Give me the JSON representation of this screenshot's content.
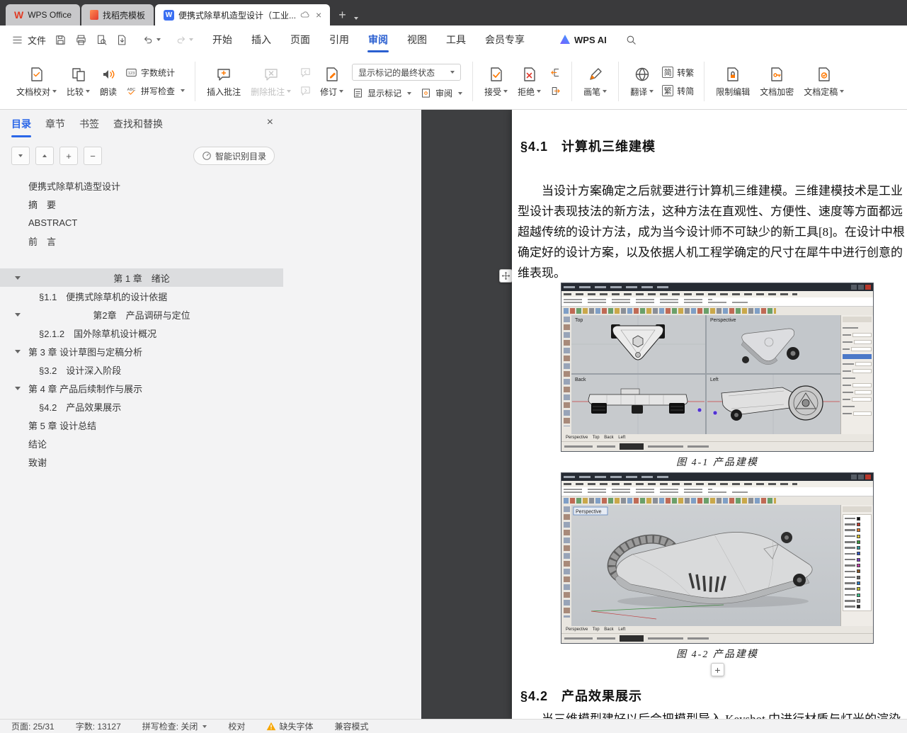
{
  "icons": {
    "close": "×",
    "plus": "+",
    "minus": "−"
  },
  "tabbar": {
    "tabs": [
      {
        "label": "WPS Office"
      },
      {
        "label": "找稻壳模板"
      },
      {
        "label": "便携式除草机造型设计（工业..."
      }
    ]
  },
  "menubar": {
    "menu": "文件",
    "tabs": [
      {
        "label": "开始"
      },
      {
        "label": "插入"
      },
      {
        "label": "页面"
      },
      {
        "label": "引用"
      },
      {
        "label": "审阅"
      },
      {
        "label": "视图"
      },
      {
        "label": "工具"
      },
      {
        "label": "会员专享"
      }
    ],
    "wps_ai": "WPS AI"
  },
  "ribbon": {
    "doc_proof": "文档校对",
    "compare": "比较",
    "read_aloud": "朗读",
    "word_count": "字数统计",
    "count_badge": "123",
    "spell_check": "拼写检查",
    "spell_badge": "ABC",
    "insert_comment": "插入批注",
    "delete_comment": "删除批注",
    "track_changes": "修订",
    "markup_state": "显示标记的最终状态",
    "show_markup": "显示标记",
    "review": "审阅",
    "accept": "接受",
    "reject": "拒绝",
    "pen": "画笔",
    "translate": "翻译",
    "jian": "简",
    "fan": "繁",
    "to_trad": "转繁",
    "to_simp": "转简",
    "restrict_edit": "限制编辑",
    "encrypt": "文档加密",
    "finalize": "文档定稿"
  },
  "sidebar": {
    "tabs": [
      {
        "label": "目录"
      },
      {
        "label": "章节"
      },
      {
        "label": "书签"
      },
      {
        "label": "查找和替换"
      }
    ],
    "smart_toc": "智能识别目录",
    "items": [
      {
        "label": "便携式除草机造型设计"
      },
      {
        "label": "摘　要"
      },
      {
        "label": "ABSTRACT"
      },
      {
        "label": "前　言"
      },
      {
        "label": "第 1 章　绪论"
      },
      {
        "label": "§1.1　便携式除草机的设计依据"
      },
      {
        "label": "第2章　产品调研与定位"
      },
      {
        "label": "§2.1.2　国外除草机设计概况"
      },
      {
        "label": "第 3 章 设计草图与定稿分析"
      },
      {
        "label": "§3.2　设计深入阶段"
      },
      {
        "label": "第 4 章 产品后续制作与展示"
      },
      {
        "label": "§4.2　产品效果展示"
      },
      {
        "label": "第 5 章 设计总结"
      },
      {
        "label": "结论"
      },
      {
        "label": "致谢"
      }
    ]
  },
  "document": {
    "heading_41": "§4.1　计算机三维建模",
    "para_41": [
      "当设计方案确定之后就要进行计算机三维建模。三维建模技术是工业",
      "型设计表现技法的新方法，这种方法在直观性、方便性、速度等方面都远",
      "超越传统的设计方法，成为当今设计师不可缺少的新工具[8]。在设计中根",
      "确定好的设计方案，以及依据人机工程学确定的尺寸在犀牛中进行创意的",
      "维表现。"
    ],
    "fig1_caption": "图 4-1 产品建模",
    "fig2_caption": "图 4-2 产品建模",
    "heading_42": "§4.2　产品效果展示",
    "para_42": "当三维模型建好以后会把模型导入 Keyshot 中进行材质与灯光的渲染",
    "vp": {
      "top": "Top",
      "perspective": "Perspective",
      "back": "Back",
      "left": "Left"
    },
    "viewport_tabs": "Perspective    Top    Back    Left"
  },
  "statusbar": {
    "page": "页面: 25/31",
    "words": "字数: 13127",
    "spell": "拼写检查: 关闭",
    "proof": "校对",
    "missing_font": "缺失字体",
    "compat": "兼容模式"
  }
}
